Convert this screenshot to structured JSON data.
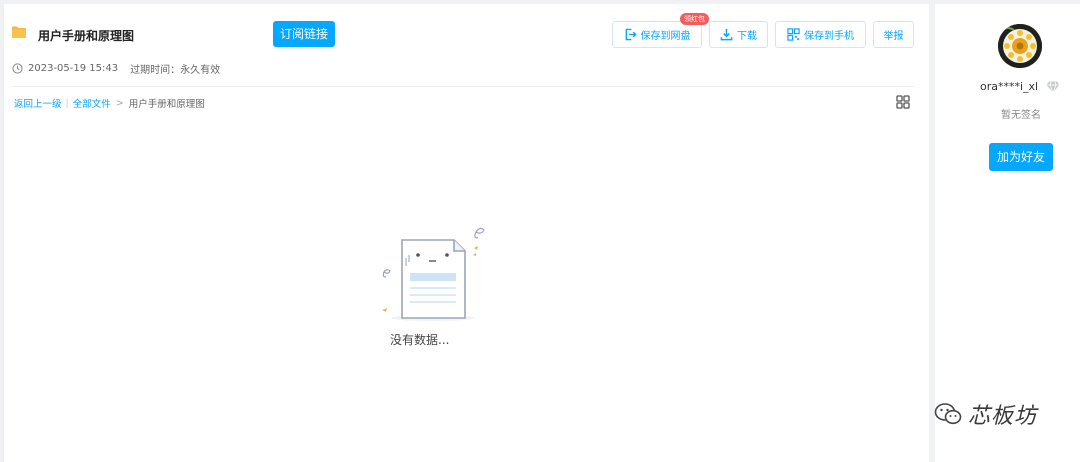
{
  "header": {
    "title": "用户手册和原理图",
    "subscribe_label": "订阅链接",
    "save_label": "保存到网盘",
    "save_badge": "领红包",
    "download_label": "下载",
    "phone_label": "保存到手机",
    "report_label": "举报"
  },
  "meta": {
    "datetime": "2023-05-19 15:43",
    "expiry": "过期时间：永久有效"
  },
  "breadcrumb": {
    "back": "返回上一级",
    "all_files": "全部文件",
    "arrow": ">",
    "current": "用户手册和原理图"
  },
  "empty": {
    "text": "没有数据..."
  },
  "profile": {
    "username": "ora****i_xl",
    "signature": "暂无签名",
    "add_friend_label": "加为好友"
  },
  "watermark": {
    "text": "芯板坊"
  },
  "colors": {
    "accent": "#06a7ff",
    "badge": "#f25d5d",
    "folder": "#f6b73c"
  },
  "icons": {
    "folder": "folder-icon",
    "save": "save-to-cloud-icon",
    "download": "download-icon",
    "phone": "qr-code-icon",
    "clock": "clock-icon",
    "grid": "grid-view-icon",
    "vip": "diamond-icon"
  }
}
